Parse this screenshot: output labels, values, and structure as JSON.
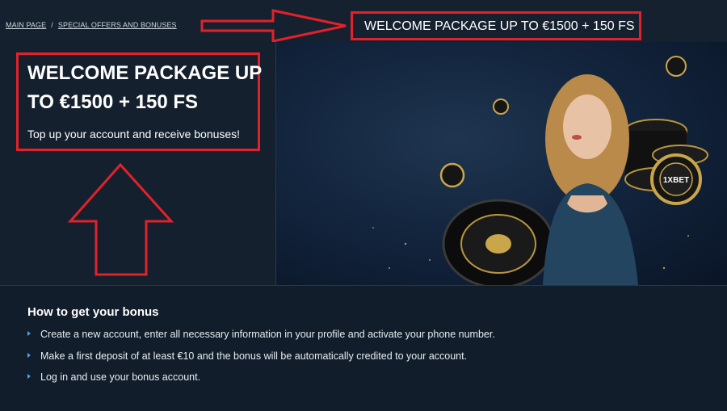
{
  "breadcrumb": {
    "main_page": "MAIN PAGE",
    "separator": "/",
    "offers": "SPECIAL OFFERS AND BONUSES"
  },
  "page": {
    "title": "WELCOME PACKAGE UP TO €1500 + 150 FS"
  },
  "hero": {
    "title": "WELCOME PACKAGE UP TO €1500 + 150 FS",
    "subtitle": "Top up your account and receive bonuses!",
    "chip_text": "1XBET"
  },
  "howto": {
    "title": "How to get your bonus",
    "steps": [
      "Create a new account, enter all necessary information in your profile and activate your phone number.",
      "Make a first deposit of at least €10 and the bonus will be automatically credited to your account.",
      "Log in and use your bonus account."
    ]
  },
  "colors": {
    "background": "#111d2a",
    "annotation_red": "#e3212b",
    "bullet_blue": "#4aa3e8"
  }
}
